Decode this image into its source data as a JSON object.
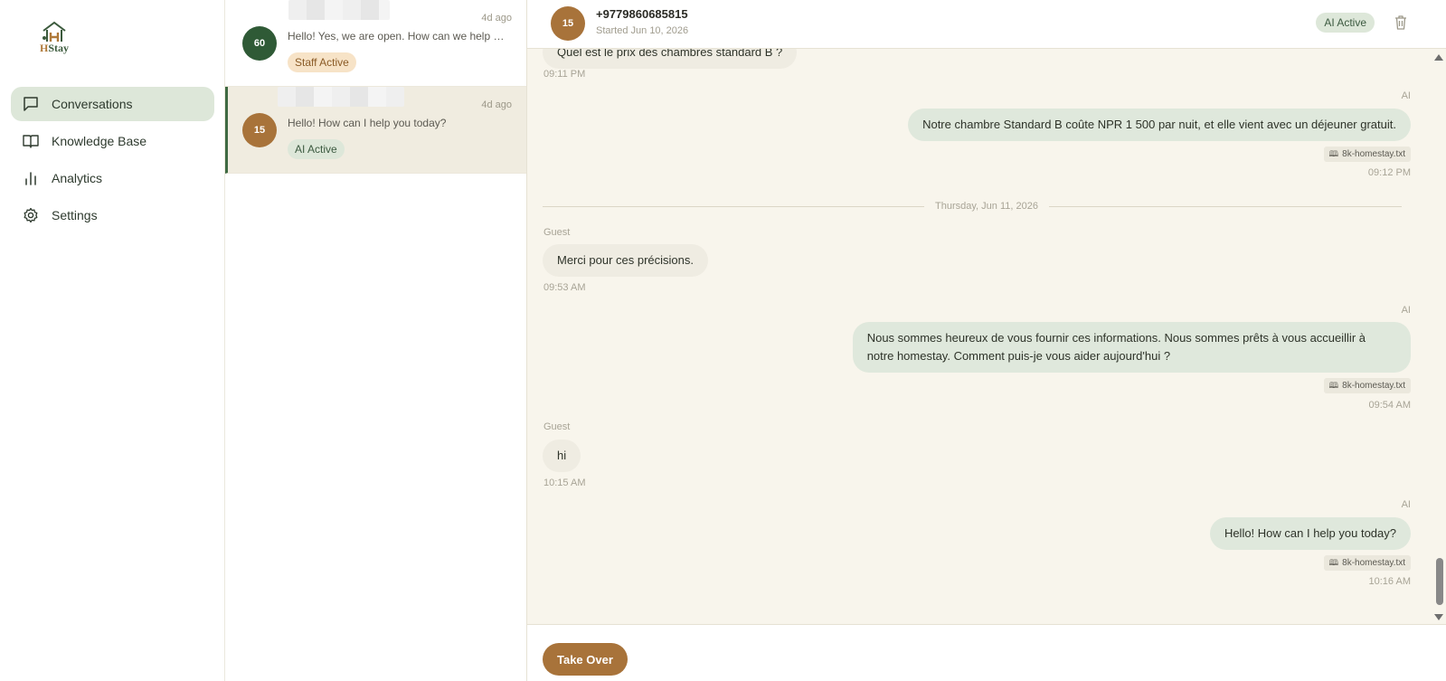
{
  "app": {
    "name_prefix": "H",
    "name_suffix": "Stay"
  },
  "sidebar": {
    "items": [
      {
        "label": "Conversations",
        "icon": "chat-bubble-icon",
        "active": true
      },
      {
        "label": "Knowledge Base",
        "icon": "open-book-icon",
        "active": false
      },
      {
        "label": "Analytics",
        "icon": "bar-chart-icon",
        "active": false
      },
      {
        "label": "Settings",
        "icon": "gear-icon",
        "active": false
      }
    ]
  },
  "conversations": [
    {
      "avatar": "60",
      "avatar_color": "#2f5a36",
      "time": "4d ago",
      "preview": "Hello! Yes, we are open. How can we help you?",
      "badge": "Staff Active"
    },
    {
      "avatar": "15",
      "avatar_color": "#a8733a",
      "time": "4d ago",
      "preview": "Hello! How can I help you today?",
      "badge": "AI Active"
    }
  ],
  "chat": {
    "avatar": "15",
    "phone": "+9779860685815",
    "started": "Started Jun 10, 2026",
    "status_badge": "AI Active",
    "partial_message": "Quel est le prix des chambres standard B ?",
    "partial_time": "09:11 PM",
    "messages": [
      {
        "sender": "AI",
        "text": "Notre chambre Standard B coûte NPR 1 500 par nuit, et elle vient avec un déjeuner gratuit.",
        "source": "8k-homestay.txt",
        "time": "09:12 PM"
      },
      {
        "sender": "Guest",
        "text": "Merci pour ces précisions.",
        "time": "09:53 AM"
      },
      {
        "sender": "AI",
        "text_line1": "Nous sommes heureux de vous fournir ces informations. Nous sommes prêts à vous accueillir à",
        "text_line2": "notre homestay. Comment puis-je vous aider aujourd'hui ?",
        "source": "8k-homestay.txt",
        "time": "09:54 AM"
      },
      {
        "sender": "Guest",
        "text": "hi",
        "time": "10:15 AM"
      },
      {
        "sender": "AI",
        "text": "Hello! How can I help you today?",
        "source": "8k-homestay.txt",
        "time": "10:16 AM"
      }
    ],
    "date_divider": "Thursday, Jun 11, 2026",
    "take_over_label": "Take Over"
  },
  "colors": {
    "accent_green": "#3f6a43",
    "accent_brown": "#a8733a",
    "ai_bubble": "#dfe8dc",
    "guest_bubble": "#efece2"
  }
}
